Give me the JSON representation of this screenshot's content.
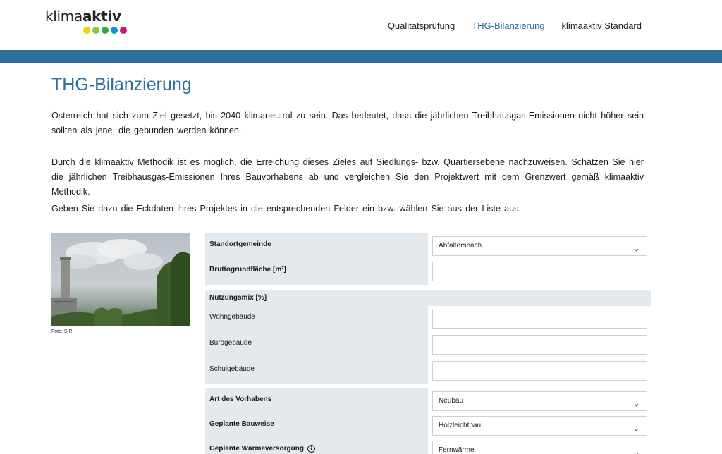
{
  "header": {
    "logo": {
      "text_regular": "klima",
      "text_bold": "aktiv"
    },
    "logo_dots": [
      "#f2d200",
      "#8cc63f",
      "#2fa84f",
      "#1b8fce",
      "#c2187f"
    ],
    "nav": [
      {
        "label": "Qualitätsprüfung",
        "active": false
      },
      {
        "label": "THG-Bilanzierung",
        "active": true
      },
      {
        "label": "klimaaktiv Standard",
        "active": false
      }
    ]
  },
  "colors": {
    "accent": "#2e6f9e",
    "form_bg": "#e4e9ee"
  },
  "main": {
    "title": "THG-Bilanzierung",
    "paragraphs": [
      "Österreich hat sich zum Ziel gesetzt, bis 2040 klimaneutral zu sein. Das bedeutet, dass die jährlichen Treibhausgas-Emissionen nicht höher sein sollten als jene, die gebunden werden können.",
      "Durch die klimaaktiv Methodik ist es möglich, die Erreichung dieses Zieles auf Siedlungs- bzw. Quartiersebene nachzuweisen. Schätzen Sie hier die jährlichen Treibhausgas-Emissionen Ihres Bauvorhabens ab und vergleichen Sie den Projektwert mit dem Grenzwert gemäß klimaaktiv Methodik.",
      "Geben Sie dazu die Eckdaten ihres Projektes in die entsprechenden Felder ein bzw. wählen Sie aus der Liste aus."
    ],
    "photo_caption": "Foto: SIR"
  },
  "form": {
    "standortgemeinde": {
      "label": "Standortgemeinde",
      "value": "Abfaltersbach"
    },
    "bruttogrundflaeche": {
      "label": "Bruttogrundfläche [m²]",
      "value": ""
    },
    "nutzungsmix": {
      "label": "Nutzungsmix [%]",
      "wohngebaeude": {
        "label": "Wohngebäude",
        "value": ""
      },
      "buerogebaeude": {
        "label": "Bürogebäude",
        "value": ""
      },
      "schulgebaeude": {
        "label": "Schulgebäude",
        "value": ""
      }
    },
    "art_des_vorhabens": {
      "label": "Art des Vorhabens",
      "value": "Neubau"
    },
    "geplante_bauweise": {
      "label": "Geplante Bauweise",
      "value": "Holzleichtbau"
    },
    "geplante_waermeversorgung": {
      "label": "Geplante Wärmeversorgung",
      "value": "Fernwärme",
      "info_icon": "info-icon"
    }
  }
}
